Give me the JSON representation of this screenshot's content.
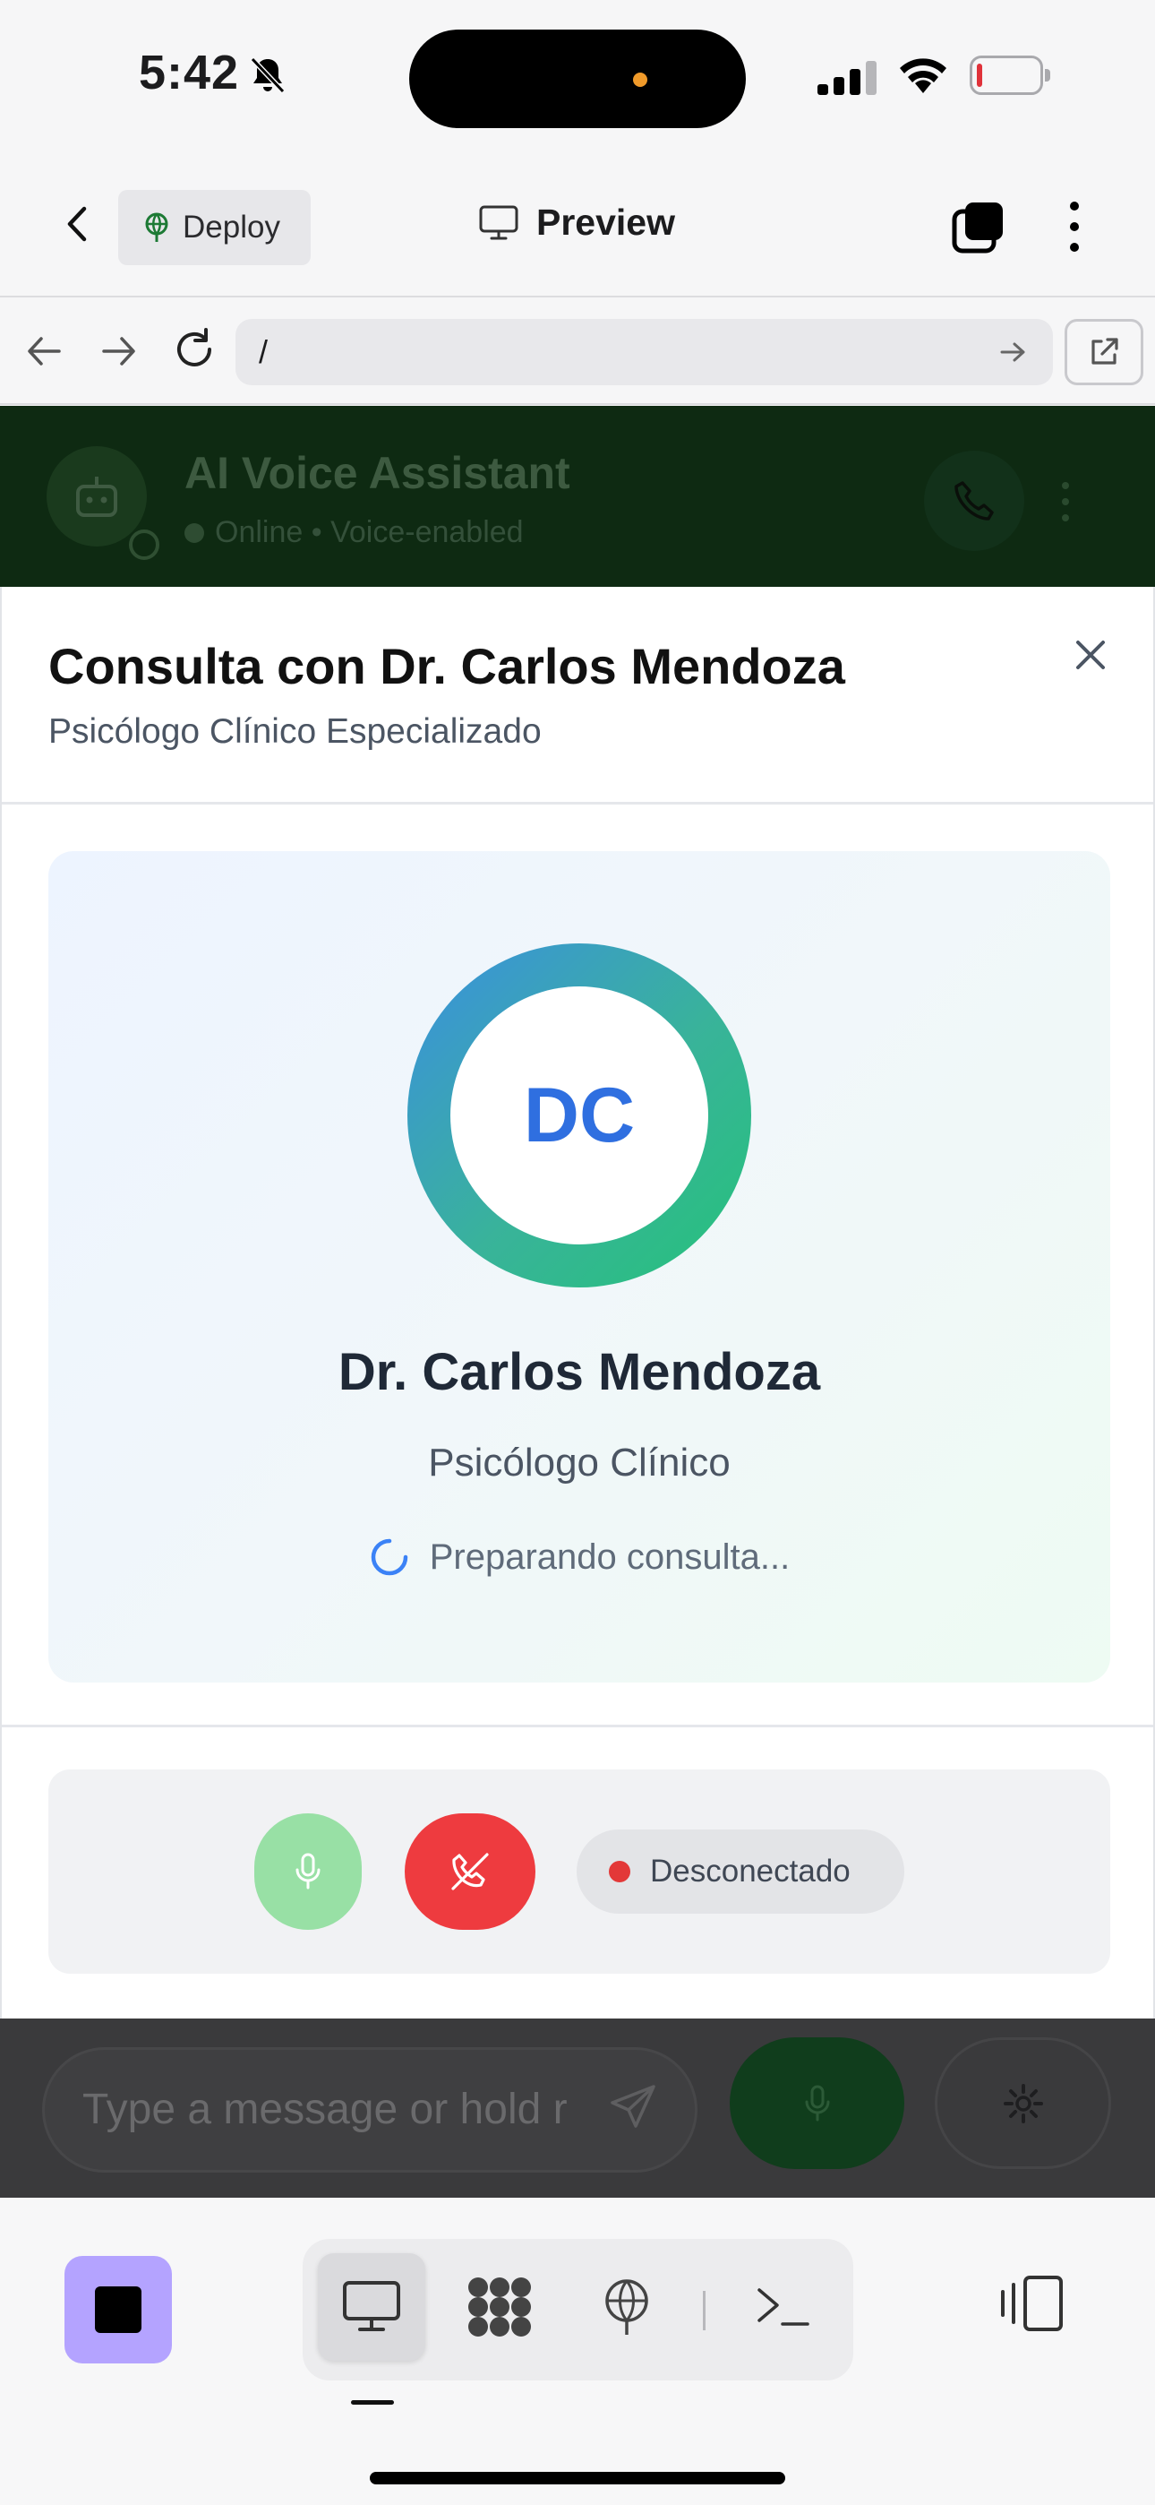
{
  "status_bar": {
    "time": "5:42",
    "icons": [
      "bell-slash-icon",
      "cellular-signal-icon",
      "wifi-icon",
      "battery-low-icon"
    ]
  },
  "app_header": {
    "deploy_label": "Deploy",
    "title": "Preview"
  },
  "url_bar": {
    "url": "/"
  },
  "background_page": {
    "title": "AI Voice Assistant",
    "subtitle": "Online • Voice-enabled",
    "message_placeholder": "Type a message or hold r"
  },
  "modal": {
    "title": "Consulta con Dr. Carlos Mendoza",
    "subtitle": "Psicólogo Clínico Especializado",
    "avatar_initials": "DC",
    "doctor_name": "Dr. Carlos Mendoza",
    "doctor_role": "Psicólogo Clínico",
    "status_text": "Preparando consulta...",
    "connection_status": "Desconectado"
  },
  "colors": {
    "accent_blue": "#2f6fe0",
    "ring_start": "#3b8fe0",
    "ring_end": "#25c27a",
    "mic_green": "#98e0a5",
    "hangup_red": "#ee3b3f",
    "status_dot": "#e33838",
    "stop_purple": "#b4a3ff"
  }
}
